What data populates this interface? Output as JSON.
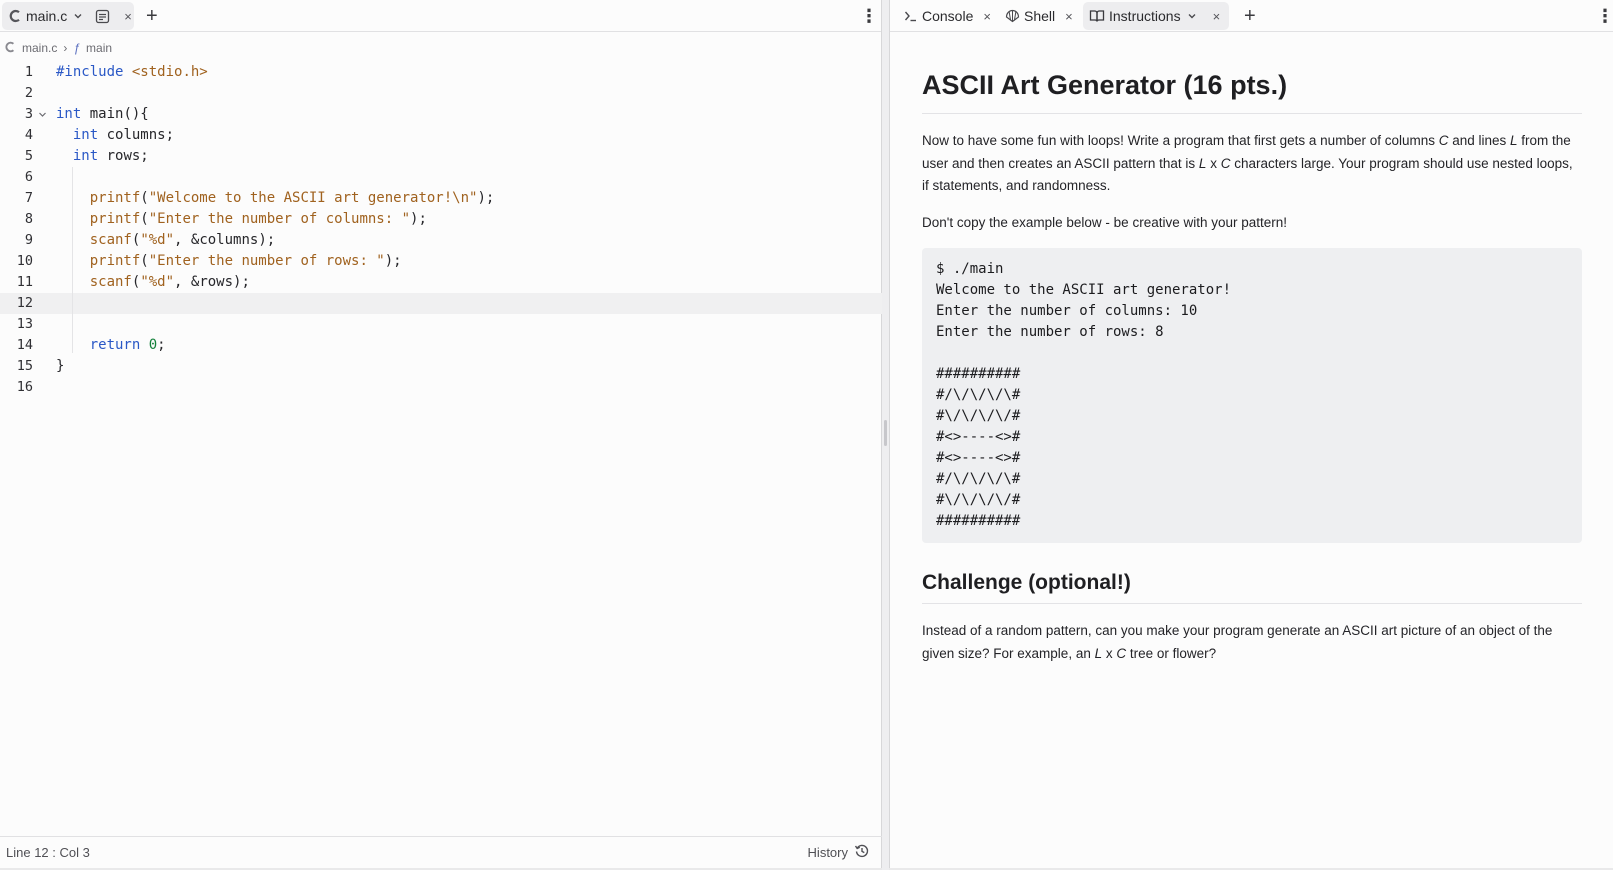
{
  "editor_tabbar": {
    "file_tab_label": "main.c",
    "new_tab_label": "+",
    "menu_label": "⋮"
  },
  "breadcrumb": {
    "file": "main.c",
    "separator": "›",
    "symbol_icon_glyph": "ƒ",
    "symbol": "main"
  },
  "code_lines": [
    {
      "n": "1",
      "html": "<span class='kw'>#include</span> <span class='str'>&lt;stdio.h&gt;</span>"
    },
    {
      "n": "2",
      "html": ""
    },
    {
      "n": "3",
      "html": "<span class='kw'>int</span> main(){",
      "fold": true
    },
    {
      "n": "4",
      "html": "  <span class='kw'>int</span> columns;"
    },
    {
      "n": "5",
      "html": "  <span class='kw'>int</span> rows;"
    },
    {
      "n": "6",
      "html": ""
    },
    {
      "n": "7",
      "html": "    <span class='fn'>printf</span>(<span class='str'>\"Welcome to the ASCII art generator!\\n\"</span>);"
    },
    {
      "n": "8",
      "html": "    <span class='fn'>printf</span>(<span class='str'>\"Enter the number of columns: \"</span>);"
    },
    {
      "n": "9",
      "html": "    <span class='fn'>scanf</span>(<span class='str'>\"%d\"</span>, &amp;columns);"
    },
    {
      "n": "10",
      "html": "    <span class='fn'>printf</span>(<span class='str'>\"Enter the number of rows: \"</span>);"
    },
    {
      "n": "11",
      "html": "    <span class='fn'>scanf</span>(<span class='str'>\"%d\"</span>, &amp;rows);"
    },
    {
      "n": "12",
      "html": "",
      "current": true
    },
    {
      "n": "13",
      "html": ""
    },
    {
      "n": "14",
      "html": "    <span class='kw'>return</span> <span class='num'>0</span>;"
    },
    {
      "n": "15",
      "html": "}"
    },
    {
      "n": "16",
      "html": ""
    }
  ],
  "statusbar": {
    "cursor": "Line 12 : Col 3",
    "history_label": "History"
  },
  "right_tabbar": {
    "console_label": "Console",
    "shell_label": "Shell",
    "instructions_label": "Instructions",
    "close_glyph": "×",
    "new_tab_label": "+",
    "menu_label": "⋮"
  },
  "instructions": {
    "title": "ASCII Art Generator (16 pts.)",
    "paragraph1_html": "Now to have some fun with loops! Write a program that first gets a number of columns <em>C</em> and lines <em>L</em> from the user and then creates an ASCII pattern that is <em>L</em> x <em>C</em> characters large. Your program should use nested loops, if statements, and randomness.",
    "paragraph2": "Don't copy the example below - be creative with your pattern!",
    "example_output": "$ ./main\nWelcome to the ASCII art generator!\nEnter the number of columns: 10\nEnter the number of rows: 8\n\n##########\n#/\\/\\/\\/\\#\n#\\/\\/\\/\\/#\n#<>----<>#\n#<>----<>#\n#/\\/\\/\\/\\#\n#\\/\\/\\/\\/#\n##########",
    "challenge_title": "Challenge (optional!)",
    "challenge_html": "Instead of a random pattern, can you make your program generate an ASCII art picture of an object of the given size? For example, an <em>L</em> x <em>C</em> tree or flower?"
  }
}
